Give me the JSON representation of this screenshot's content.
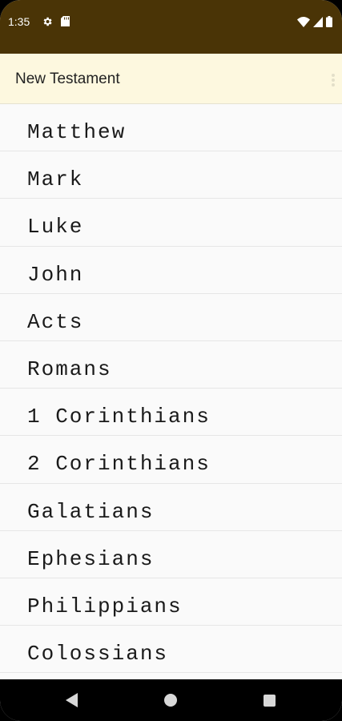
{
  "status_bar": {
    "time": "1:35",
    "icons": [
      "gear-icon",
      "sd-card-icon",
      "wifi-icon",
      "signal-icon",
      "battery-icon"
    ],
    "background_color": "#4a3406"
  },
  "app_bar": {
    "title": "New Testament",
    "background_color": "#fdf8df"
  },
  "books": [
    {
      "label": "Matthew"
    },
    {
      "label": "Mark"
    },
    {
      "label": "Luke"
    },
    {
      "label": "John"
    },
    {
      "label": "Acts"
    },
    {
      "label": "Romans"
    },
    {
      "label": "1 Corinthians"
    },
    {
      "label": "2 Corinthians"
    },
    {
      "label": "Galatians"
    },
    {
      "label": "Ephesians"
    },
    {
      "label": "Philippians"
    },
    {
      "label": "Colossians"
    }
  ],
  "nav_bar": {
    "icons": [
      "back-icon",
      "home-icon",
      "recents-icon"
    ]
  }
}
